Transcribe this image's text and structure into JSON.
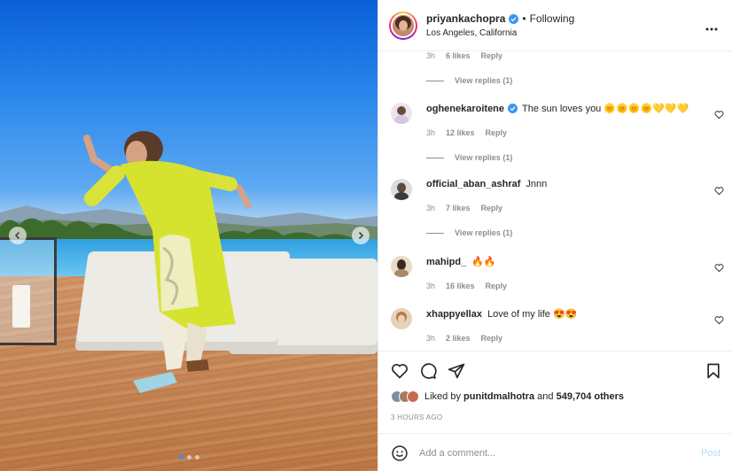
{
  "post": {
    "username": "priyankachopra",
    "separator": "•",
    "follow_label": "Following",
    "location": "Los Angeles, California",
    "more_icon": "more-horizontal-icon"
  },
  "carousel": {
    "slide_count": 3,
    "active_index": 0,
    "prev_icon": "chevron-left-icon",
    "next_icon": "chevron-right-icon"
  },
  "comments": [
    {
      "username": "",
      "text": "",
      "time": "3h",
      "likes": "6 likes",
      "reply": "Reply",
      "view_replies": "View replies (1)",
      "partial": true
    },
    {
      "username": "oghenekaroitene",
      "verified": true,
      "text": "The sun loves you 🌞🌞🌞🌞💛💛💛",
      "time": "3h",
      "likes": "12 likes",
      "reply": "Reply",
      "view_replies": "View replies (1)"
    },
    {
      "username": "official_aban_ashraf",
      "text": "Jnnn",
      "time": "3h",
      "likes": "7 likes",
      "reply": "Reply",
      "view_replies": "View replies (1)"
    },
    {
      "username": "mahipd_",
      "text": "🔥🔥",
      "time": "3h",
      "likes": "16 likes",
      "reply": "Reply"
    },
    {
      "username": "xhappyellax",
      "text": "Love of my life 😍😍",
      "time": "3h",
      "likes": "2 likes",
      "reply": "Reply"
    }
  ],
  "actions": {
    "like_icon": "heart-icon",
    "comment_icon": "comment-icon",
    "share_icon": "paper-plane-icon",
    "save_icon": "bookmark-icon"
  },
  "likes": {
    "prefix": "Liked by",
    "user": "punitdmalhotra",
    "middle": "and",
    "others": "549,704 others"
  },
  "timestamp": "3 HOURS AGO",
  "composer": {
    "placeholder": "Add a comment...",
    "post_label": "Post",
    "emoji_icon": "smiley-icon"
  },
  "colors": {
    "verified": "#3897f0",
    "muted": "#8e8e8e",
    "post_disabled": "#b2dffc"
  }
}
